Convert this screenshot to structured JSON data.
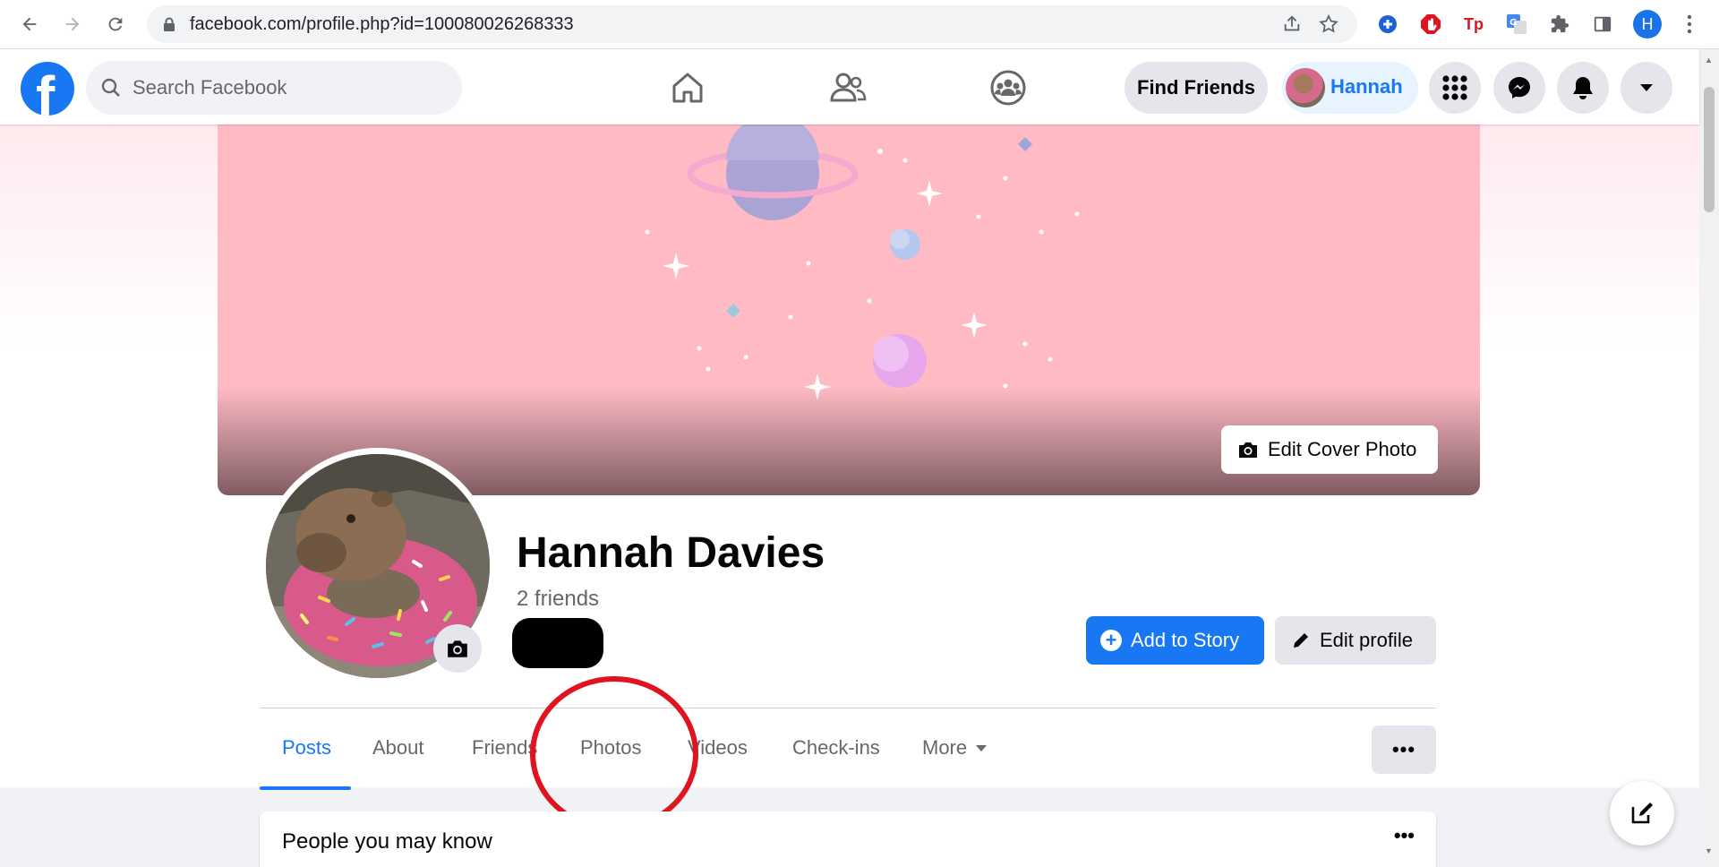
{
  "browser": {
    "url": "facebook.com/profile.php?id=100080026268333",
    "profile_initial": "H",
    "extensions": [
      "grammarly-icon",
      "adblock-icon",
      "tp-icon",
      "translate-icon",
      "puzzle-icon"
    ],
    "ext_tp_label": "Tp"
  },
  "header": {
    "search_placeholder": "Search Facebook",
    "find_friends": "Find Friends",
    "user_name": "Hannah"
  },
  "cover": {
    "edit_label": "Edit Cover Photo",
    "bg_color": "#ffbac4"
  },
  "profile": {
    "name": "Hannah Davies",
    "friends": "2 friends",
    "add_story": "Add to Story",
    "edit_profile": "Edit profile"
  },
  "tabs": [
    {
      "label": "Posts",
      "active": true
    },
    {
      "label": "About"
    },
    {
      "label": "Friends"
    },
    {
      "label": "Photos"
    },
    {
      "label": "Videos"
    },
    {
      "label": "Check-ins"
    },
    {
      "label": "More"
    }
  ],
  "tab_more_dots": "•••",
  "pymk": {
    "title": "People you may know",
    "dots": "•••"
  },
  "colors": {
    "fb_blue": "#1877f2",
    "annotation_red": "#e0141e"
  }
}
